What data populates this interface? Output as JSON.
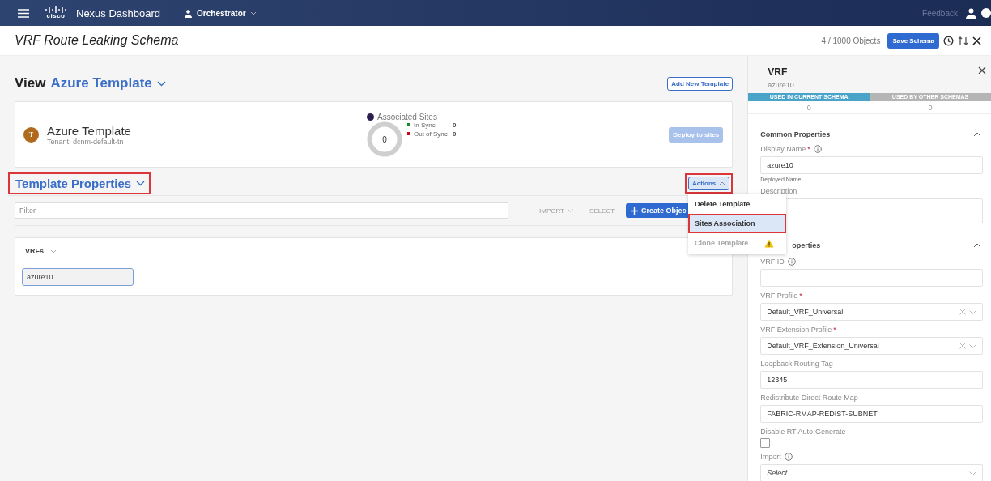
{
  "topbar": {
    "logo": "cisco",
    "product": "Nexus Dashboard",
    "app": "Orchestrator",
    "feedback": "Feedback"
  },
  "header": {
    "title": "VRF Route Leaking Schema",
    "objects": "4 / 1000 Objects",
    "save_button": "Save Schema"
  },
  "view": {
    "label": "View",
    "template": "Azure Template",
    "add_button": "Add New Template"
  },
  "template_card": {
    "avatar": "T",
    "name": "Azure Template",
    "tenant": "Tenant: dcnm-default-tn",
    "sites_title": "Associated Sites",
    "total": "0",
    "deploy_button": "Deploy to sites",
    "deploy_disabled": true,
    "legend": [
      {
        "label": "In Sync",
        "value": "0",
        "color": "#1a8a2a"
      },
      {
        "label": "Out of Sync",
        "value": "0",
        "color": "#d0021b"
      }
    ]
  },
  "properties": {
    "title": "Template Properties",
    "highlighted": true,
    "actions": {
      "label": "Actions",
      "highlighted": true,
      "expanded": true
    }
  },
  "menu": [
    {
      "label": "Delete Template",
      "selected": false,
      "highlighted": false,
      "disabled": false,
      "warning": false
    },
    {
      "label": "Sites Association",
      "selected": true,
      "highlighted": true,
      "disabled": false,
      "warning": false
    },
    {
      "label": "Clone Template",
      "selected": false,
      "highlighted": false,
      "disabled": true,
      "warning": true
    }
  ],
  "toolbar": {
    "filter_placeholder": "Filter",
    "import": "IMPORT",
    "select": "SELECT",
    "create": "Create Objec"
  },
  "vrfs": {
    "title": "VRFs",
    "items": [
      "azure10"
    ]
  },
  "panel": {
    "title": "VRF",
    "subtitle": "azure10",
    "usage": [
      {
        "label": "USED IN CURRENT SCHEMA",
        "count": "0",
        "color": "#4aa3c9"
      },
      {
        "label": "USED BY OTHER SCHEMAS",
        "count": "0",
        "color": "#b5b5b5"
      }
    ],
    "sections": [
      {
        "title": "Common Properties",
        "expanded": true,
        "fields": [
          {
            "kind": "text",
            "label": "Display Name",
            "required_mark": "*",
            "info": true,
            "value": "azure10",
            "hint": "Deployed Name:"
          },
          {
            "kind": "textarea",
            "label": "Description",
            "info": false
          }
        ]
      },
      {
        "title": "operties",
        "expanded": true,
        "fields": [
          {
            "kind": "text",
            "label": "VRF ID",
            "info": true
          },
          {
            "kind": "select",
            "label": "VRF Profile",
            "required_mark": "*",
            "info": false,
            "value": "Default_VRF_Universal",
            "clearable": true
          },
          {
            "kind": "select",
            "label": "VRF Extension Profile",
            "required_mark": "*",
            "info": false,
            "value": "Default_VRF_Extension_Universal",
            "clearable": true
          },
          {
            "kind": "text",
            "label": "Loopback Routing Tag",
            "info": false,
            "value": "12345"
          },
          {
            "kind": "text",
            "label": "Redistribute Direct Route Map",
            "info": false,
            "value": "FABRIC-RMAP-REDIST-SUBNET"
          },
          {
            "kind": "checkbox",
            "label": "Disable RT Auto-Generate",
            "info": false,
            "checked": false
          },
          {
            "kind": "select",
            "label": "Import",
            "info": true,
            "placeholder": "Select...",
            "clearable": false
          }
        ]
      }
    ]
  }
}
